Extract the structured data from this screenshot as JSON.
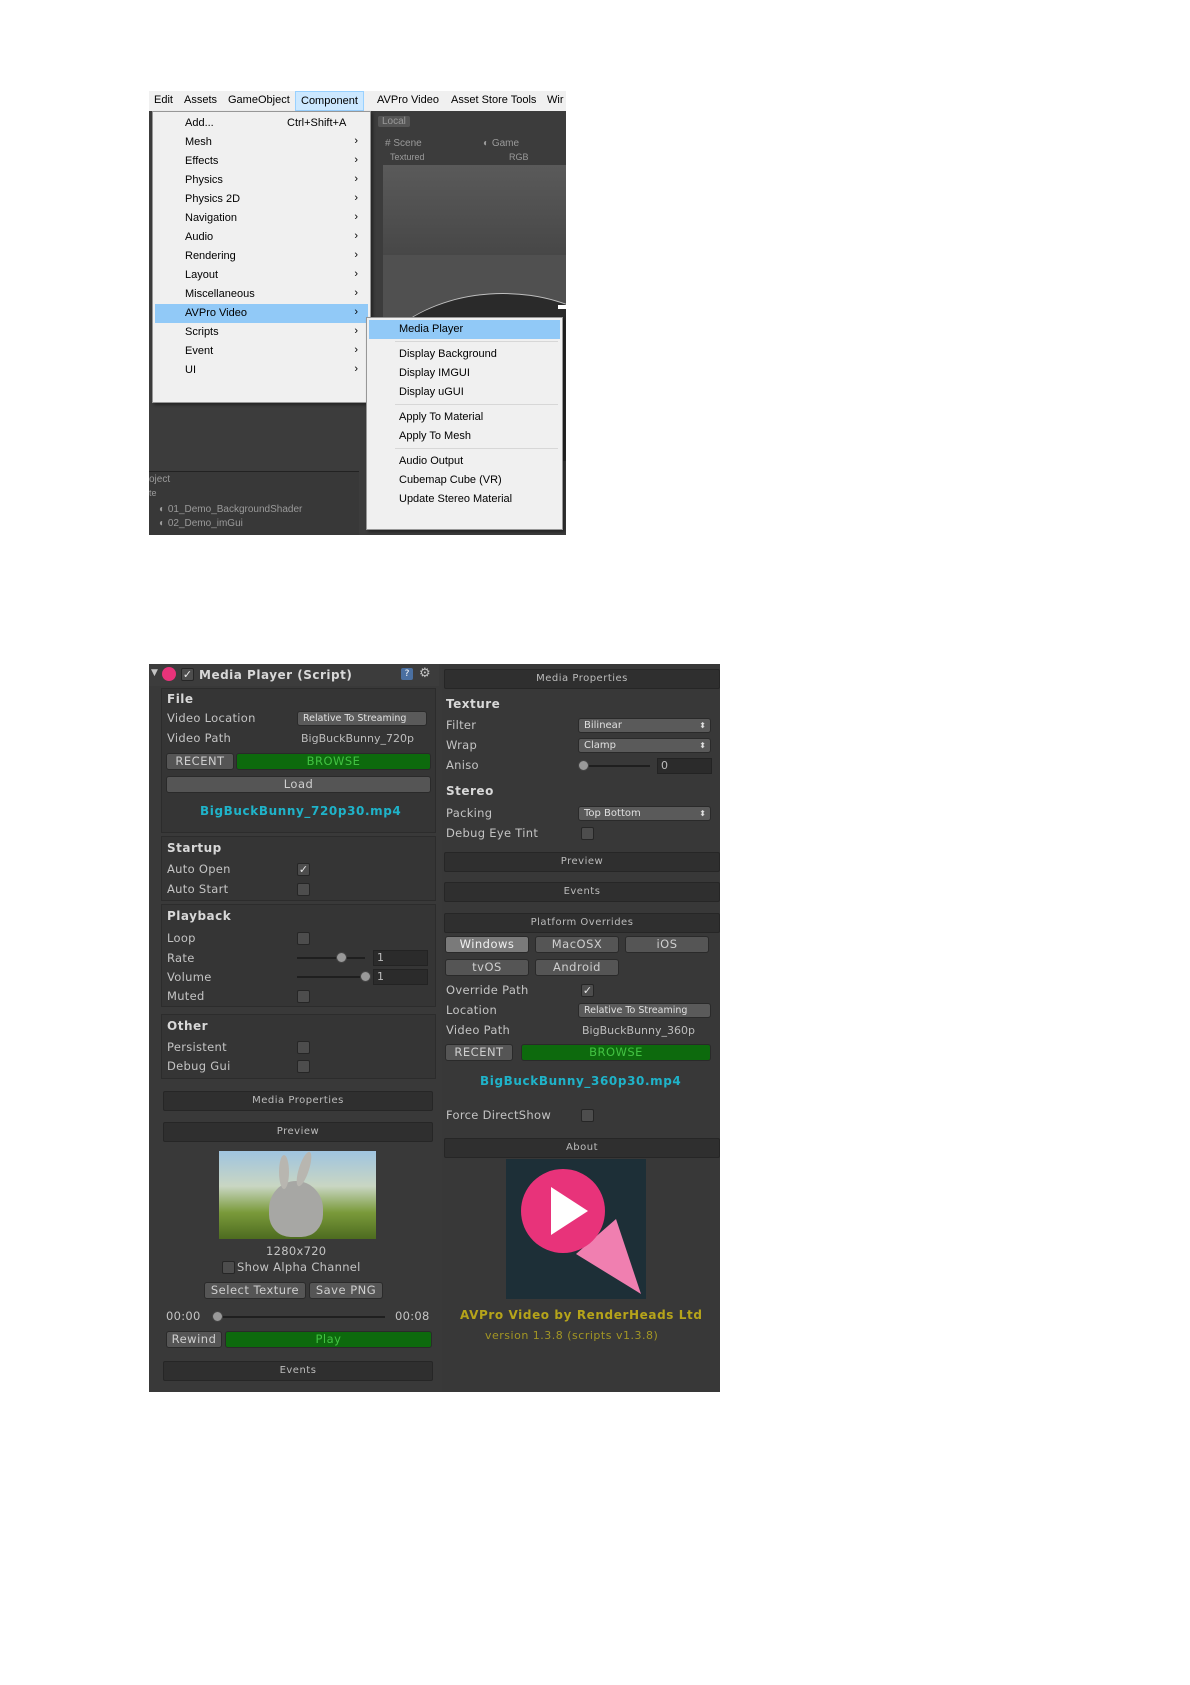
{
  "menu_screenshot": {
    "menubar": [
      "Edit",
      "Assets",
      "GameObject",
      "Component",
      "AVPro Video",
      "Asset Store Tools",
      "Wir"
    ],
    "editor": {
      "local_label": "Local",
      "scene_tab": "Scene",
      "game_tab": "Game",
      "textured_label": "Textured",
      "rgb_label": "RGB",
      "project_label": "oject",
      "create_label": "te",
      "items": [
        "01_Demo_BackgroundShader",
        "02_Demo_imGui"
      ]
    },
    "component_menu": {
      "add_label": "Add...",
      "add_shortcut": "Ctrl+Shift+A",
      "items": [
        "Mesh",
        "Effects",
        "Physics",
        "Physics 2D",
        "Navigation",
        "Audio",
        "Rendering",
        "Layout",
        "Miscellaneous",
        "AVPro Video",
        "Scripts",
        "Event",
        "UI"
      ],
      "highlighted": "AVPro Video"
    },
    "avpro_submenu": {
      "items": [
        "Media Player",
        "Display Background",
        "Display IMGUI",
        "Display uGUI",
        "Apply To Material",
        "Apply To Mesh",
        "Audio Output",
        "Cubemap Cube (VR)",
        "Update Stereo Material"
      ],
      "highlighted": "Media Player"
    },
    "colors": {
      "highlight": "#91c9f7",
      "active_menubar": "#cce8ff"
    }
  },
  "inspector": {
    "title": "Media Player (Script)",
    "file": {
      "header": "File",
      "video_location_label": "Video Location",
      "video_location_value": "Relative To Streaming",
      "video_path_label": "Video Path",
      "video_path_value": "BigBuckBunny_720p",
      "recent_label": "RECENT",
      "browse_label": "BROWSE",
      "load_label": "Load",
      "filename": "BigBuckBunny_720p30.mp4"
    },
    "startup": {
      "header": "Startup",
      "auto_open_label": "Auto Open",
      "auto_open_checked": true,
      "auto_start_label": "Auto Start",
      "auto_start_checked": false
    },
    "playback": {
      "header": "Playback",
      "loop_label": "Loop",
      "rate_label": "Rate",
      "rate_value": "1",
      "volume_label": "Volume",
      "volume_value": "1",
      "muted_label": "Muted"
    },
    "other": {
      "header": "Other",
      "persistent_label": "Persistent",
      "debug_gui_label": "Debug Gui"
    },
    "media_properties_label": "Media Properties",
    "preview": {
      "header": "Preview",
      "resolution": "1280x720",
      "show_alpha_label": "Show Alpha Channel",
      "select_texture_label": "Select Texture",
      "save_png_label": "Save PNG",
      "time_start": "00:00",
      "time_end": "00:08",
      "rewind_label": "Rewind",
      "play_label": "Play"
    },
    "events_label": "Events"
  },
  "right_panel": {
    "media_properties_header": "Media Properties",
    "texture": {
      "header": "Texture",
      "filter_label": "Filter",
      "filter_value": "Bilinear",
      "wrap_label": "Wrap",
      "wrap_value": "Clamp",
      "aniso_label": "Aniso",
      "aniso_value": "0"
    },
    "stereo": {
      "header": "Stereo",
      "packing_label": "Packing",
      "packing_value": "Top Bottom",
      "debug_eye_tint_label": "Debug Eye Tint"
    },
    "preview_label": "Preview",
    "events_label": "Events",
    "platform_overrides": {
      "header": "Platform Overrides",
      "platforms": [
        "Windows",
        "MacOSX",
        "iOS",
        "tvOS",
        "Android"
      ],
      "selected": "Windows",
      "override_path_label": "Override Path",
      "location_label": "Location",
      "location_value": "Relative To Streaming",
      "video_path_label": "Video Path",
      "video_path_value": "BigBuckBunny_360p",
      "recent_label": "RECENT",
      "browse_label": "BROWSE",
      "filename": "BigBuckBunny_360p30.mp4"
    },
    "force_directshow_label": "Force DirectShow",
    "about": {
      "header": "About",
      "credit": "AVPro Video by RenderHeads Ltd",
      "version": "version 1.3.8 (scripts v1.3.8)"
    },
    "colors": {
      "accent_cyan": "#1fb3c9",
      "logo_pink": "#e8337a",
      "logo_light_pink": "#f07fb0",
      "credit_yellow": "#b6a41a"
    }
  }
}
